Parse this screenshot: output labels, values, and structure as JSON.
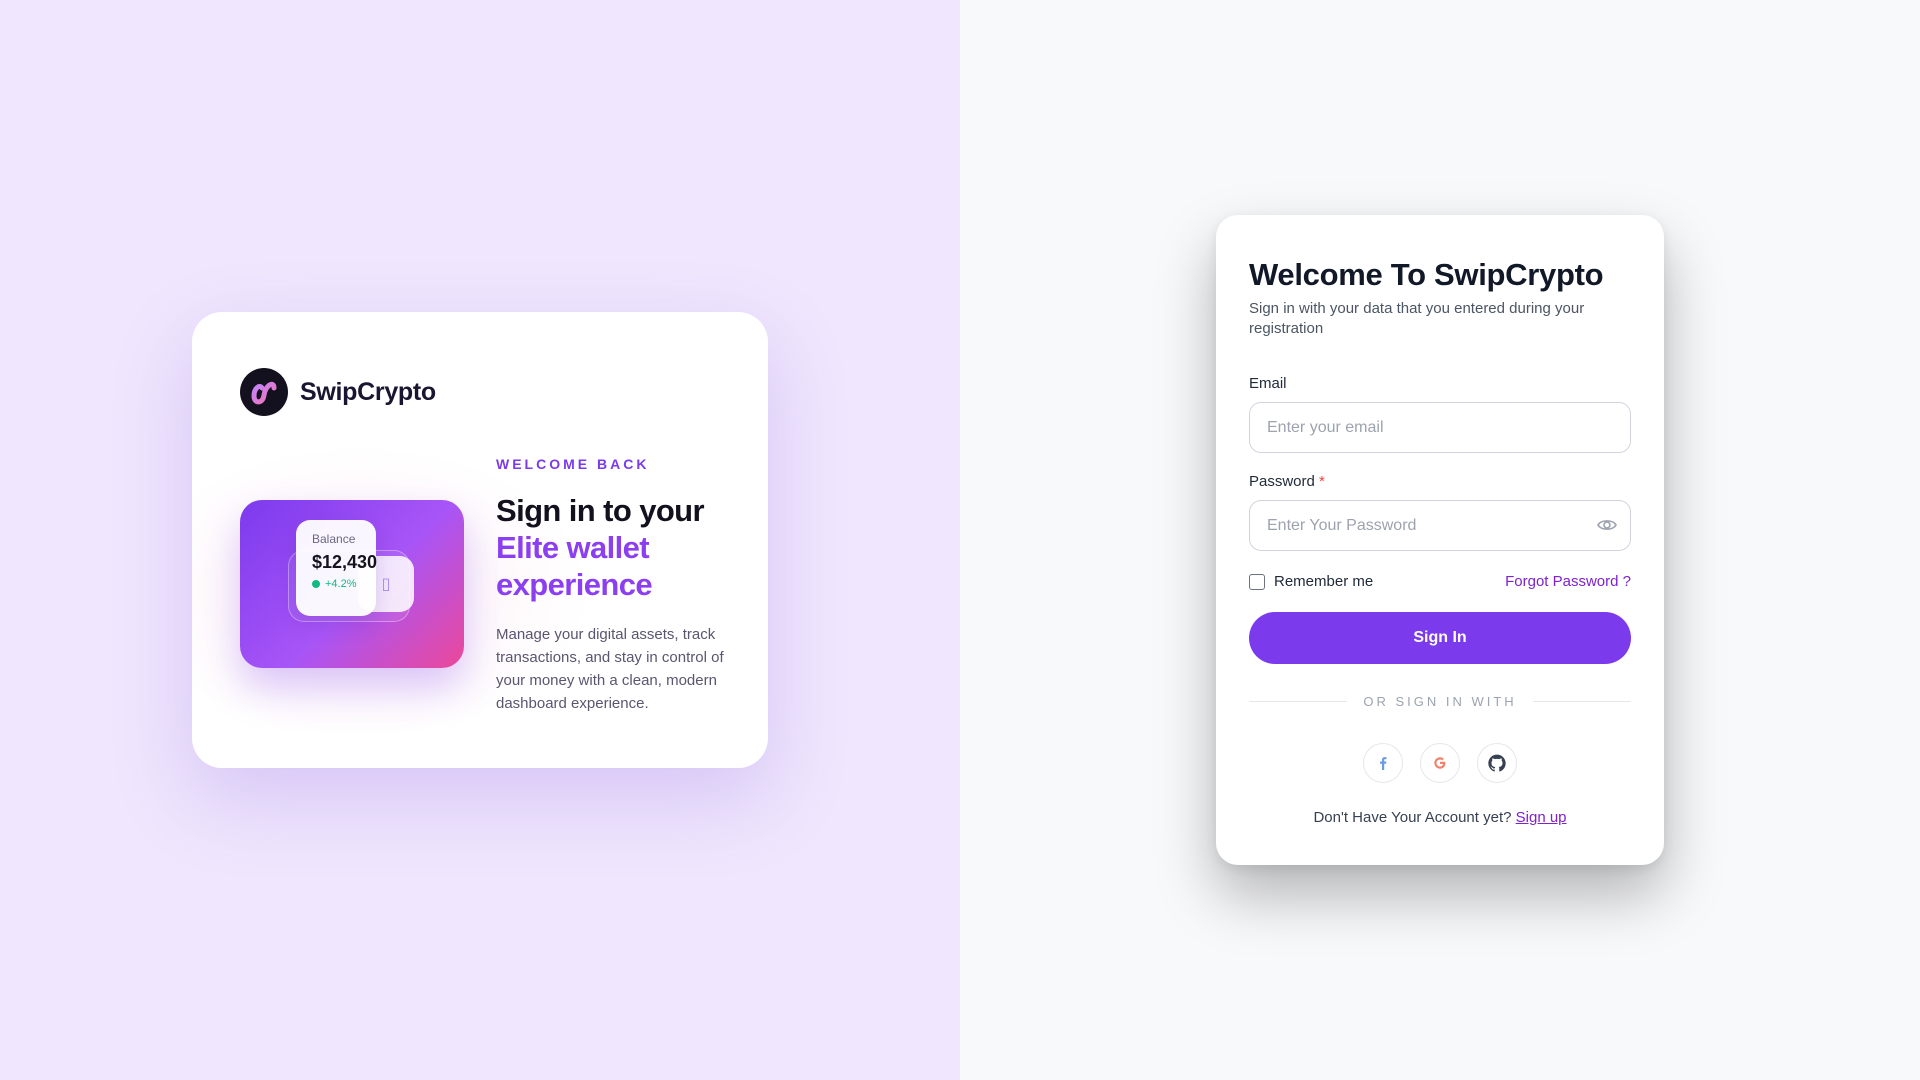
{
  "brand": {
    "name": "SwipCrypto"
  },
  "promo": {
    "eyebrow": "WELCOME BACK",
    "headline_line1": "Sign in to your",
    "headline_accent": "Elite wallet experience",
    "description": "Manage your digital assets, track transactions, and stay in control of your money with a clean, modern dashboard experience.",
    "balance_label": "Balance",
    "balance_value": "$12,430",
    "balance_change": "+4.2%"
  },
  "login": {
    "title": "Welcome To SwipCrypto",
    "subtitle": "Sign in with your data that you entered during your registration",
    "email_label": "Email",
    "email_placeholder": "Enter your email",
    "password_label": "Password",
    "password_required_mark": "*",
    "password_placeholder": "Enter Your Password",
    "remember_label": "Remember me",
    "forgot_label": "Forgot Password ?",
    "submit_label": "Sign In",
    "divider_text": "OR SIGN IN WITH",
    "social_icons": [
      "facebook-icon",
      "google-icon",
      "github-icon"
    ],
    "signup_prompt": "Don't Have Your Account yet?",
    "signup_link": "Sign up"
  },
  "colors": {
    "accent": "#7c3aed",
    "accent_text": "#8b3ff0",
    "left_bg": "#f0e6fd",
    "right_bg": "#f8f9fb",
    "positive": "#10b981",
    "required": "#ef4444"
  }
}
